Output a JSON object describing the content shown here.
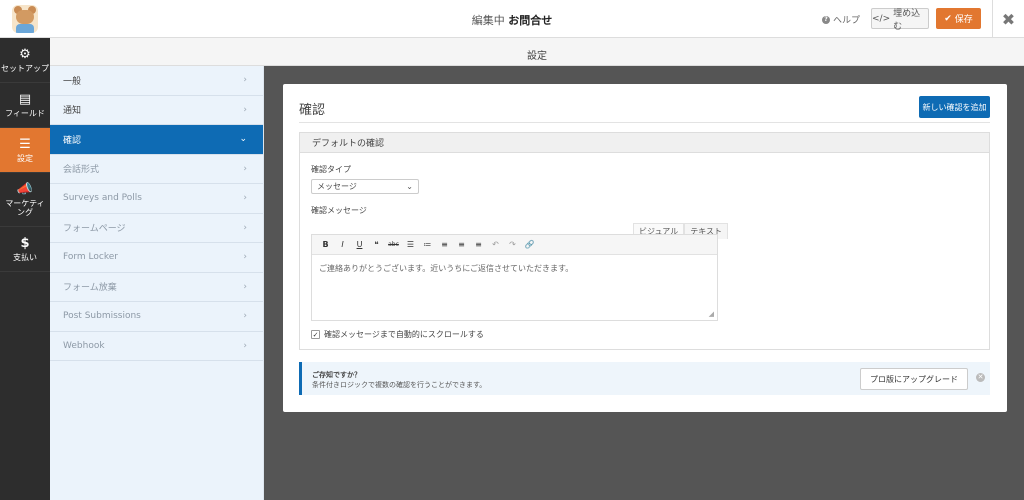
{
  "header": {
    "title_prefix": "編集中",
    "title_name": "お問合せ",
    "help_label": "ヘルプ",
    "embed_label": "埋め込む",
    "embed_icon": "</>",
    "save_label": "保存",
    "close_icon": "✖"
  },
  "sidebar": {
    "items": [
      {
        "label": "セットアップ",
        "icon": "⚙"
      },
      {
        "label": "フィールド",
        "icon": "▤"
      },
      {
        "label": "設定",
        "icon": "☰"
      },
      {
        "label": "マーケティング",
        "icon": "📣"
      },
      {
        "label": "支払い",
        "icon": "$"
      }
    ]
  },
  "section": {
    "title": "設定"
  },
  "subnav": {
    "items": [
      {
        "label": "一般",
        "chev": "›"
      },
      {
        "label": "通知",
        "chev": "›"
      },
      {
        "label": "確認",
        "chev": "⌄"
      },
      {
        "label": "会話形式",
        "chev": "›"
      },
      {
        "label": "Surveys and Polls",
        "chev": "›"
      },
      {
        "label": "フォームページ",
        "chev": "›"
      },
      {
        "label": "Form Locker",
        "chev": "›"
      },
      {
        "label": "フォーム放棄",
        "chev": "›"
      },
      {
        "label": "Post Submissions",
        "chev": "›"
      },
      {
        "label": "Webhook",
        "chev": "›"
      }
    ]
  },
  "panel": {
    "title": "確認",
    "add_button": "新しい確認を追加",
    "box_title": "デフォルトの確認",
    "type_label": "確認タイプ",
    "type_value": "メッセージ",
    "message_label": "確認メッセージ",
    "tab_visual": "ビジュアル",
    "tab_text": "テキスト",
    "toolbar": [
      "B",
      "I",
      "U",
      "❝",
      "abc",
      "☰",
      "≔",
      "≡",
      "≡",
      "≡",
      "↶",
      "↷",
      "🔗"
    ],
    "message_text": "ご連絡ありがとうございます。近いうちにご返信させていただきます。",
    "scroll_label": "確認メッセージまで自動的にスクロールする"
  },
  "notice": {
    "title": "ご存知ですか？",
    "body": "条件付きロジックで複数の確認を行うことができます。",
    "upgrade_label": "プロ版にアップグレード"
  },
  "colors": {
    "accent_orange": "#e27730",
    "accent_blue": "#0e6bb4",
    "sidebar_dark": "#2d2d2d",
    "main_gray": "#555555"
  }
}
